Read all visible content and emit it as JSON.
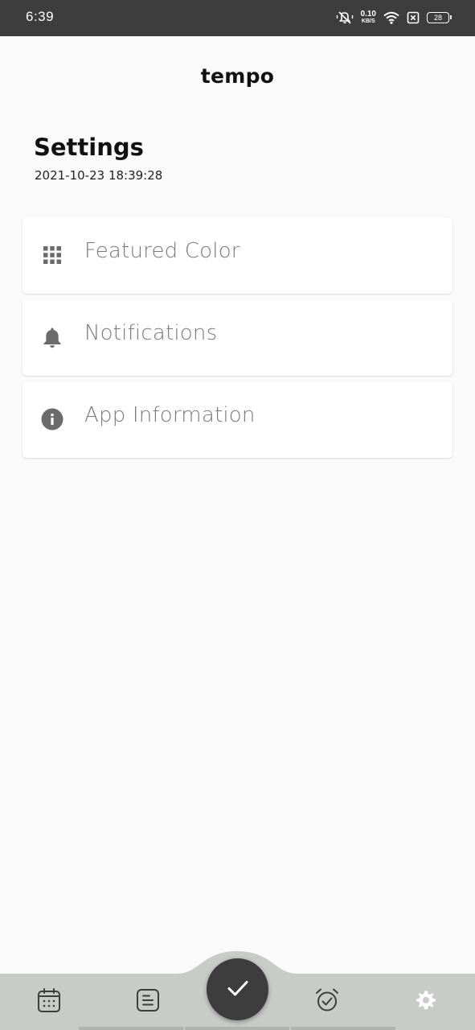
{
  "status_bar": {
    "time": "6:39",
    "net_speed_value": "0.10",
    "net_speed_unit": "KB/S",
    "battery_level": "28",
    "icons": [
      "mute-vibrate-icon",
      "wifi-icon",
      "sim-off-icon",
      "battery-icon"
    ]
  },
  "header": {
    "app_title": "tempo"
  },
  "page": {
    "title": "Settings",
    "timestamp": "2021-10-23 18:39:28"
  },
  "menu": {
    "items": [
      {
        "label": "Featured Color",
        "icon": "grid-icon"
      },
      {
        "label": "Notifications",
        "icon": "bell-icon"
      },
      {
        "label": "App Information",
        "icon": "info-icon"
      }
    ]
  },
  "bottom_nav": {
    "items": [
      {
        "name": "calendar",
        "icon": "calendar-icon"
      },
      {
        "name": "notes",
        "icon": "notes-icon"
      },
      {
        "name": "complete",
        "icon": "check-icon"
      },
      {
        "name": "alarm",
        "icon": "alarm-check-icon"
      },
      {
        "name": "settings",
        "icon": "gear-icon",
        "active": true
      }
    ]
  },
  "colors": {
    "status_bar": "#3d3d3d",
    "background": "#fafafa",
    "nav_bar": "#c8ccc7",
    "fab": "#3d3d3d",
    "icon_gray": "#6b6b6b"
  }
}
